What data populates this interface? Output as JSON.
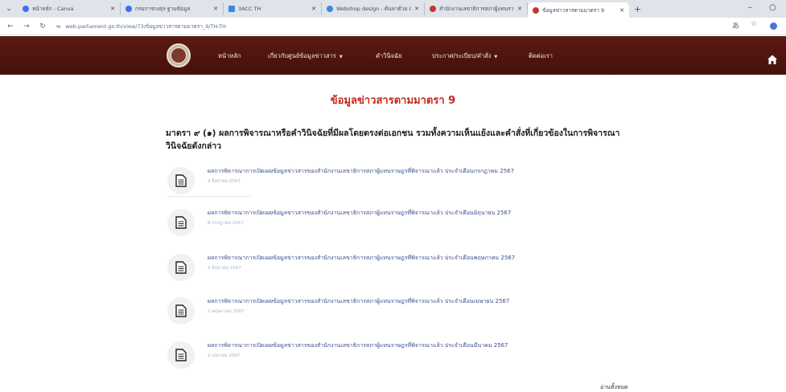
{
  "browser": {
    "tabs": [
      {
        "label": "หน้าหลัก - Canva",
        "color": "#3d6ff0"
      },
      {
        "label": "กรมการกงสุล ฐานข้อมูล",
        "color": "#3d6ff0"
      },
      {
        "label": "3ACC TH",
        "color": "#3b8ad8"
      },
      {
        "label": "Webshop design - ค้นหาด้วย Google",
        "color": "#3b8ad8"
      },
      {
        "label": "สำนักงานเลขาธิการสภาผู้แทนราษฎร",
        "color": "#c0392b"
      },
      {
        "label": "ข้อมูลข่าวสารตามมาตรา 9",
        "color": "#c0392b"
      }
    ],
    "url": "web.parliament.go.th/view/73/ข้อมูลข่าวสารตามมาตรา_9/TH-TH"
  },
  "nav": {
    "items": [
      {
        "label": "หน้าหลัก"
      },
      {
        "label": "เกี่ยวกับศูนย์ข้อมูลข่าวสาร",
        "dropdown": true
      },
      {
        "label": "คำวินิจฉัย"
      },
      {
        "label": "ประกาศ/ระเบียบ/คำสั่ง",
        "dropdown": true
      },
      {
        "label": "ติดต่อเรา"
      }
    ]
  },
  "page": {
    "title": "ข้อมูลข่าวสารตามมาตรา 9",
    "section_line1": "มาตรา ๙ (๑) ผลการพิจารณาหรือคำวินิจฉัยที่มีผลโดยตรงต่อเอกชน รวมทั้งความเห็นแย้งและคำสั่งที่เกี่ยวข้องในการพิจารณา",
    "section_line2": "วินิจฉัยดังกล่าว",
    "items": [
      {
        "title": "ผลการพิจารณาการเปิดเผยข้อมูลข่าวสารของสำนักงานเลขาธิการสภาผู้แทนราษฎรที่พิจารณาแล้ว ประจำเดือนกรกฎาคม 2567",
        "date": "9 สิงหาคม 2567"
      },
      {
        "title": "ผลการพิจารณาการเปิดเผยข้อมูลข่าวสารของสำนักงานเลขาธิการสภาผู้แทนราษฎรที่พิจารณาแล้ว ประจำเดือนมิถุนายน 2567",
        "date": "8 กรกฎาคม 2567"
      },
      {
        "title": "ผลการพิจารณาการเปิดเผยข้อมูลข่าวสารของสำนักงานเลขาธิการสภาผู้แทนราษฎรที่พิจารณาแล้ว ประจำเดือนพฤษภาคม 2567",
        "date": "4 มิถุนายน 2567"
      },
      {
        "title": "ผลการพิจารณาการเปิดเผยข้อมูลข่าวสารของสำนักงานเลขาธิการสภาผู้แทนราษฎรที่พิจารณาแล้ว ประจำเดือนเมษายน 2567",
        "date": "1 พฤษภาคม 2567"
      },
      {
        "title": "ผลการพิจารณาการเปิดเผยข้อมูลข่าวสารของสำนักงานเลขาธิการสภาผู้แทนราษฎรที่พิจารณาแล้ว ประจำเดือนมีนาคม 2567",
        "date": "9 เมษายน 2567"
      }
    ],
    "read_all": "อ่านทั้งหมด"
  }
}
